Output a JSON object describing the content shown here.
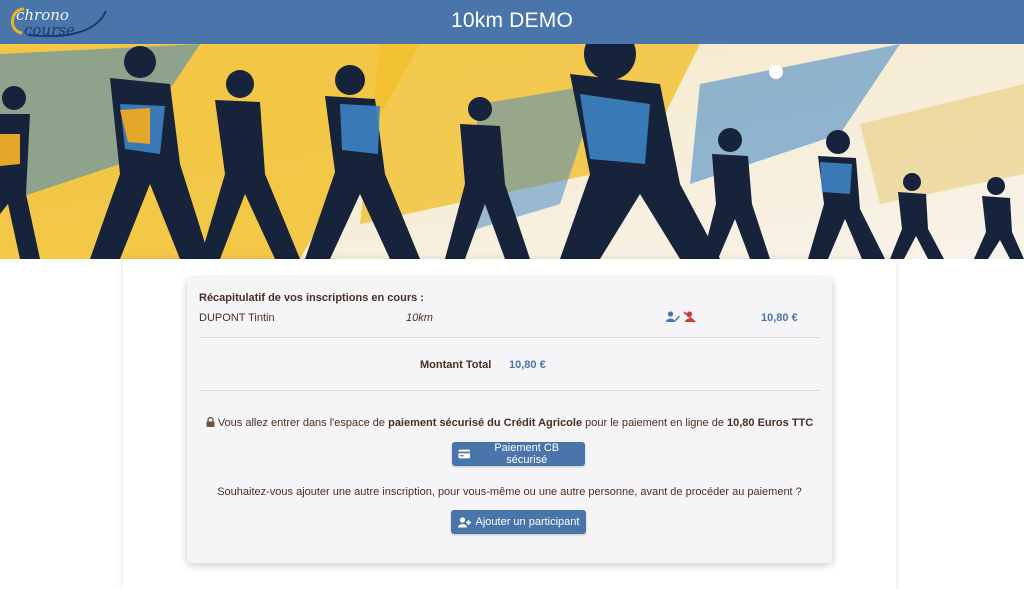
{
  "header": {
    "title": "10km DEMO",
    "logo_text_top": "chrono",
    "logo_text_bottom": "course"
  },
  "recap": {
    "title": "Récapitulatif de vos inscriptions en cours :",
    "entries": [
      {
        "name": "DUPONT Tintin",
        "race": "10km",
        "amount": "10,80 €"
      }
    ],
    "icons": [
      "edit-participant-icon",
      "remove-participant-icon"
    ]
  },
  "total": {
    "label": "Montant Total",
    "value": "10,80 €"
  },
  "payment": {
    "text_before": "Vous allez entrer dans l'espace de ",
    "text_bold1": "paiement sécurisé du Crédit Agricole",
    "text_middle": " pour le paiement en ligne de ",
    "text_bold2": "10,80 Euros TTC",
    "button_label": "Paiement CB sécurisé",
    "icon": "credit-card-icon"
  },
  "add": {
    "question": "Souhaitez-vous ajouter une autre inscription, pour vous-même ou une autre personne, avant de procéder au paiement ?",
    "button_label": "Ajouter un participant",
    "icon": "user-plus-icon"
  },
  "colors": {
    "header": "#4a75aa",
    "accent": "#4a75aa",
    "text": "#4a2f22",
    "banner_yellow": "#f2c12e",
    "banner_blue": "#3d83c4",
    "banner_dark": "#16233a"
  }
}
